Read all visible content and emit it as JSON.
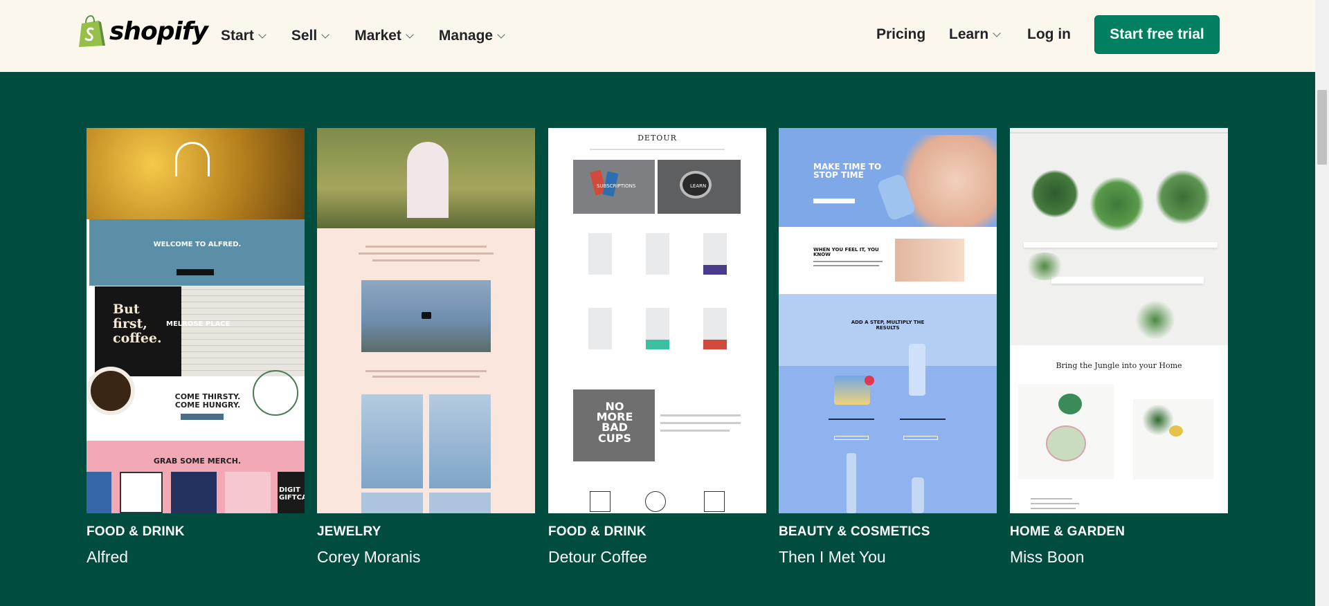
{
  "header": {
    "logo_text": "shopify",
    "nav_left": [
      "Start",
      "Sell",
      "Market",
      "Manage"
    ],
    "pricing": "Pricing",
    "learn": "Learn",
    "login": "Log in",
    "cta": "Start free trial"
  },
  "colors": {
    "header_bg": "#fbf7ed",
    "page_bg": "#004c3f",
    "cta_bg": "#008060",
    "logo_green": "#95bf47"
  },
  "examples": [
    {
      "category": "FOOD & DRINK",
      "name": "Alfred",
      "thumb": {
        "welcome": "WELCOME TO ALFRED.",
        "but_first": "But first, coffee.",
        "melrose": "MELROSE PLACE",
        "come_thirsty": "COME THIRSTY. COME HUNGRY.",
        "merch": "GRAB SOME MERCH.",
        "gift": "DIGIT GIFTCA"
      }
    },
    {
      "category": "JEWELRY",
      "name": "Corey Moranis",
      "thumb": {}
    },
    {
      "category": "FOOD & DRINK",
      "name": "Detour Coffee",
      "thumb": {
        "brand": "DETOUR",
        "subscriptions": "SUBSCRIPTIONS",
        "learn": "LEARN",
        "no_more": "NO MORE BAD CUPS"
      }
    },
    {
      "category": "BEAUTY & COSMETICS",
      "name": "Then I Met You",
      "thumb": {
        "make_time": "MAKE TIME TO STOP TIME",
        "feel_it": "WHEN YOU FEEL IT, YOU KNOW",
        "add_step": "ADD A STEP, MULTIPLY THE RESULTS"
      }
    },
    {
      "category": "HOME & GARDEN",
      "name": "Miss Boon",
      "thumb": {
        "tagline": "Bring the Jungle into your Home"
      }
    }
  ]
}
